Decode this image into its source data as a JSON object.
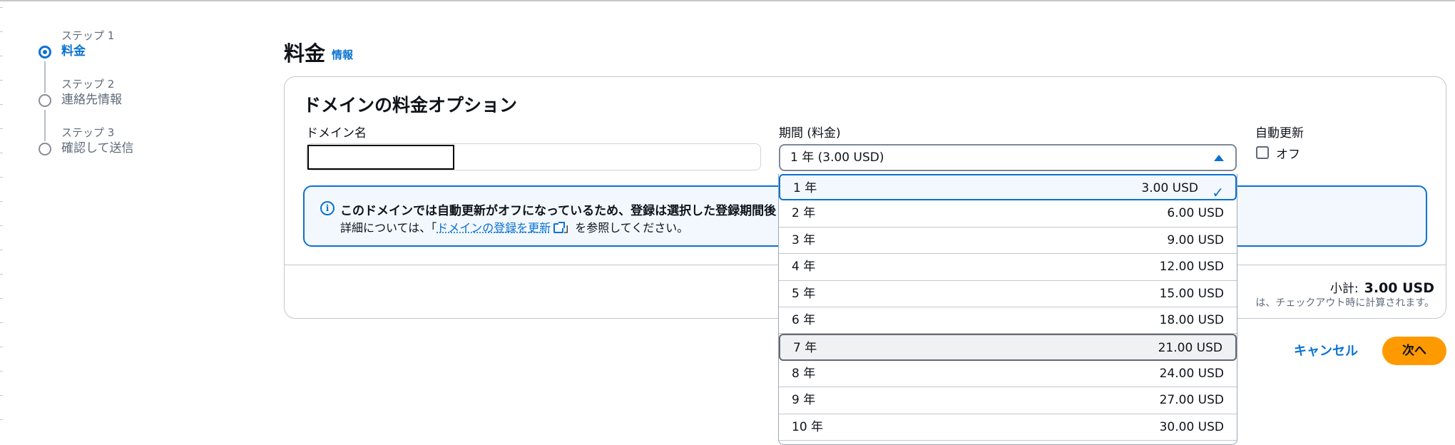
{
  "steps": [
    {
      "small": "ステップ 1",
      "label": "料金"
    },
    {
      "small": "ステップ 2",
      "label": "連絡先情報"
    },
    {
      "small": "ステップ 3",
      "label": "確認して送信"
    }
  ],
  "header": {
    "title": "料金",
    "info": "情報"
  },
  "panel": {
    "title": "ドメインの料金オプション",
    "domain_label": "ドメイン名",
    "domain_value": "",
    "period_label": "期間 (料金)",
    "period_value": "1 年 (3.00 USD)",
    "auto_renew_label": "自動更新",
    "auto_renew_value": "オフ",
    "alert_strong": "このドメインでは自動更新がオフになっているため、登録は選択した登録期間後",
    "alert_prefix": "詳細については、「",
    "alert_link": "ドメインの登録を更新",
    "alert_suffix": "」を参照してください。",
    "subtotal_label": "小計:",
    "subtotal_value": "3.00 USD",
    "subtotal_note": "は、チェックアウト時に計算されます。"
  },
  "footer": {
    "cancel": "キャンセル",
    "next": "次へ"
  },
  "dropdown": {
    "options": [
      {
        "label": "1 年",
        "price": "3.00 USD"
      },
      {
        "label": "2 年",
        "price": "6.00 USD"
      },
      {
        "label": "3 年",
        "price": "9.00 USD"
      },
      {
        "label": "4 年",
        "price": "12.00 USD"
      },
      {
        "label": "5 年",
        "price": "15.00 USD"
      },
      {
        "label": "6 年",
        "price": "18.00 USD"
      },
      {
        "label": "7 年",
        "price": "21.00 USD"
      },
      {
        "label": "8 年",
        "price": "24.00 USD"
      },
      {
        "label": "9 年",
        "price": "27.00 USD"
      },
      {
        "label": "10 年",
        "price": "30.00 USD"
      }
    ],
    "selected_index": 0,
    "hovered_index": 6
  },
  "colors": {
    "accent": "#0972d3",
    "primary_button": "#ff9900",
    "border": "#c6c6cd"
  }
}
